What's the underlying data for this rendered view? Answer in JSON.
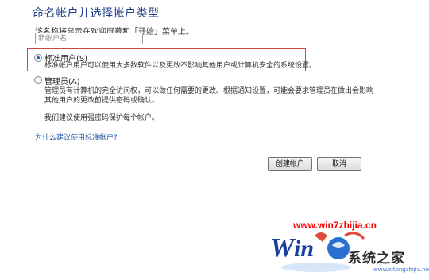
{
  "dialog": {
    "title": "命名帐户并选择帐户类型",
    "subtitle": "该名称将显示在欢迎屏幕和「开始」菜单上。",
    "name_input": {
      "value": "",
      "placeholder": "新帐户名"
    },
    "options": [
      {
        "label": "标准用户(S)",
        "selected": true,
        "description": "标准帐户用户可以使用大多数软件以及更改不影响其他用户或计算机安全的系统设置。"
      },
      {
        "label": "管理员(A)",
        "selected": false,
        "description_lines": [
          "管理员有计算机的完全访问权，可以做任何需要的更改。根据通知设置，可能会要求管理员在做出会影响",
          "其他用户的更改前提供密码或确认。",
          "我们建议使用强密码保护每个帐户。"
        ]
      }
    ],
    "help_link": "为什么建议使用标准帐户?",
    "buttons": {
      "create": "创建帐户",
      "cancel": "取消"
    }
  },
  "watermark": {
    "url": "www.win7zhijia.cn",
    "brand": "系统之家",
    "small": "www.xitongzhijia.net"
  },
  "colors": {
    "title": "#1e3f8a",
    "link": "#2257a8",
    "highlight_border": "#c8463d",
    "watermark_url": "#ff0000"
  }
}
